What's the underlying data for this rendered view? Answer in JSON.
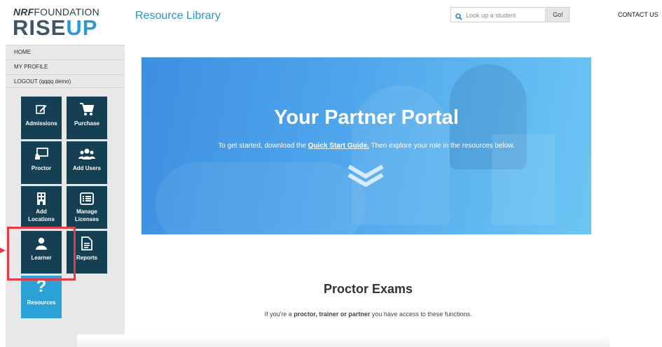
{
  "logo": {
    "nrf": "NRF",
    "foundation": "FOUNDATION",
    "rise": "RISE",
    "up": "UP"
  },
  "nav": [
    {
      "label": "HOME"
    },
    {
      "label": "MY PROFILE"
    },
    {
      "label": "LOGOUT (qqqq demo)"
    }
  ],
  "tiles": {
    "admissions": {
      "label": "Admissions",
      "icon": "edit-icon"
    },
    "purchase": {
      "label": "Purchase",
      "icon": "cart-icon"
    },
    "proctor": {
      "label": "Proctor",
      "icon": "presentation-icon"
    },
    "add_users": {
      "label": "Add Users",
      "icon": "users-icon"
    },
    "add_locations": {
      "label": "Add Locations",
      "icon": "building-icon"
    },
    "manage_licenses": {
      "label": "Manage Licenses",
      "icon": "list-icon"
    },
    "learner": {
      "label": "Learner",
      "icon": "user-icon"
    },
    "reports": {
      "label": "Reports",
      "icon": "document-icon"
    },
    "resources": {
      "label": "Resources",
      "icon": "question-icon"
    }
  },
  "header": {
    "title": "Resource Library",
    "search_placeholder": "Look up a student",
    "go_label": "Go!",
    "contact_label": "CONTACT US"
  },
  "hero": {
    "title": "Your Partner Portal",
    "sub_before": "To get started, download the ",
    "sub_link": "Quick Start Guide.",
    "sub_after": " Then explore your role in the resources below."
  },
  "section": {
    "title": "Proctor Exams",
    "sub_before": "If you're a ",
    "sub_bold": "proctor, trainer or partner",
    "sub_after": " you have access to these functions."
  },
  "colors": {
    "tile": "#153f52",
    "tile_active": "#2ba1d8",
    "accent": "#2a93cf",
    "highlight": "#e23b47"
  }
}
